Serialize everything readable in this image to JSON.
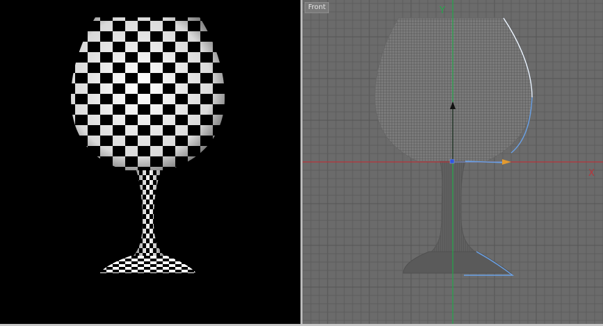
{
  "render_viewport": {
    "texture": "checker",
    "colors": {
      "background": "#000000",
      "checker_light": "#ffffff",
      "checker_dark": "#000000"
    }
  },
  "front_viewport": {
    "label": "Front",
    "x_axis_label": "X",
    "y_axis_label": "Y",
    "colors": {
      "background": "#6b6b6b",
      "grid_minor": "#5d5d5d",
      "grid_major": "#545454",
      "x_axis": "#b8333a",
      "y_axis": "#22a84a",
      "wire": "#555555",
      "selection": "#6aa2e8",
      "handle": "#e39a2f"
    }
  }
}
